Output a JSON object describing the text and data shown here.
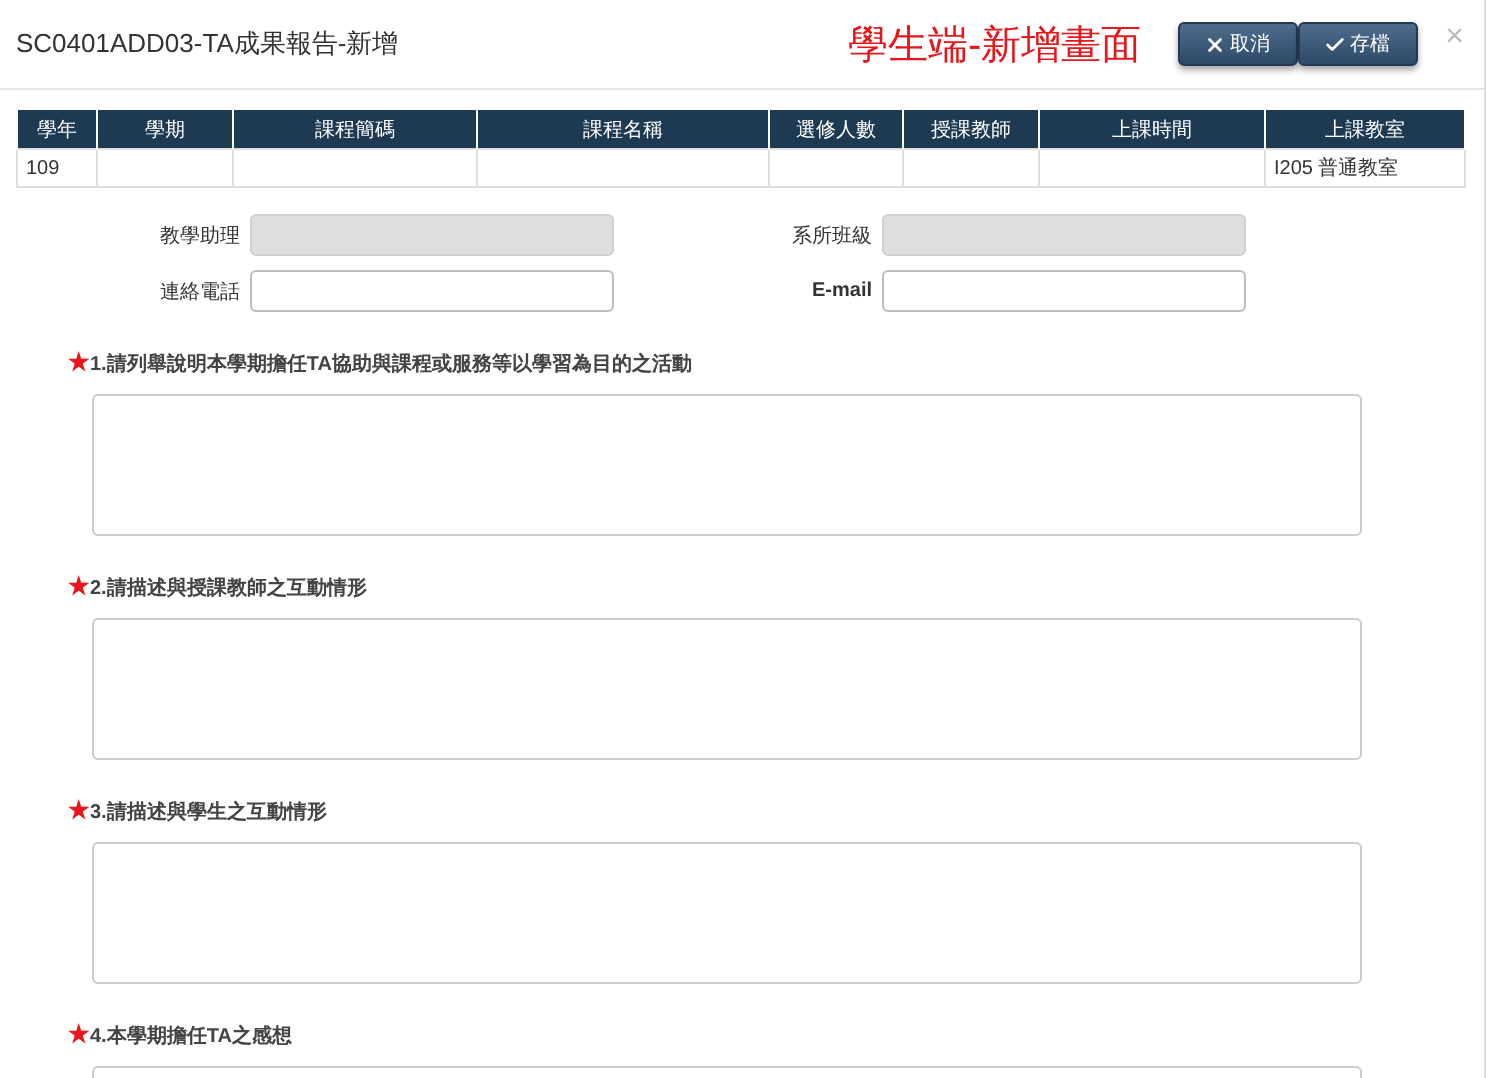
{
  "window": {
    "title": "SC0401ADD03-TA成果報告-新增",
    "annotation": "學生端-新增畫面",
    "close": "×"
  },
  "buttons": [
    {
      "kind": "cancel",
      "label": "取消"
    },
    {
      "kind": "save",
      "label": "存檔"
    }
  ],
  "table": {
    "columns": [
      "學年",
      "學期",
      "課程簡碼",
      "課程名稱",
      "選修人數",
      "授課教師",
      "上課時間",
      "上課教室"
    ],
    "rows": [
      [
        "109",
        "",
        "",
        "",
        "",
        "",
        "",
        "I205 普通教室"
      ]
    ]
  },
  "fields": [
    {
      "label": "教學助理",
      "disabled": true
    },
    {
      "label": "系所班級",
      "disabled": true
    },
    {
      "label": "連絡電話",
      "disabled": false
    },
    {
      "label": "E-mail",
      "disabled": false
    }
  ],
  "questions": [
    {
      "mark": "★",
      "label": "1.請列舉說明本學期擔任TA協助與課程或服務等以學習為目的之活動"
    },
    {
      "mark": "★",
      "label": "2.請描述與授課教師之互動情形"
    },
    {
      "mark": "★",
      "label": "3.請描述與學生之互動情形"
    },
    {
      "mark": "★",
      "label": "4.本學期擔任TA之感想"
    }
  ]
}
